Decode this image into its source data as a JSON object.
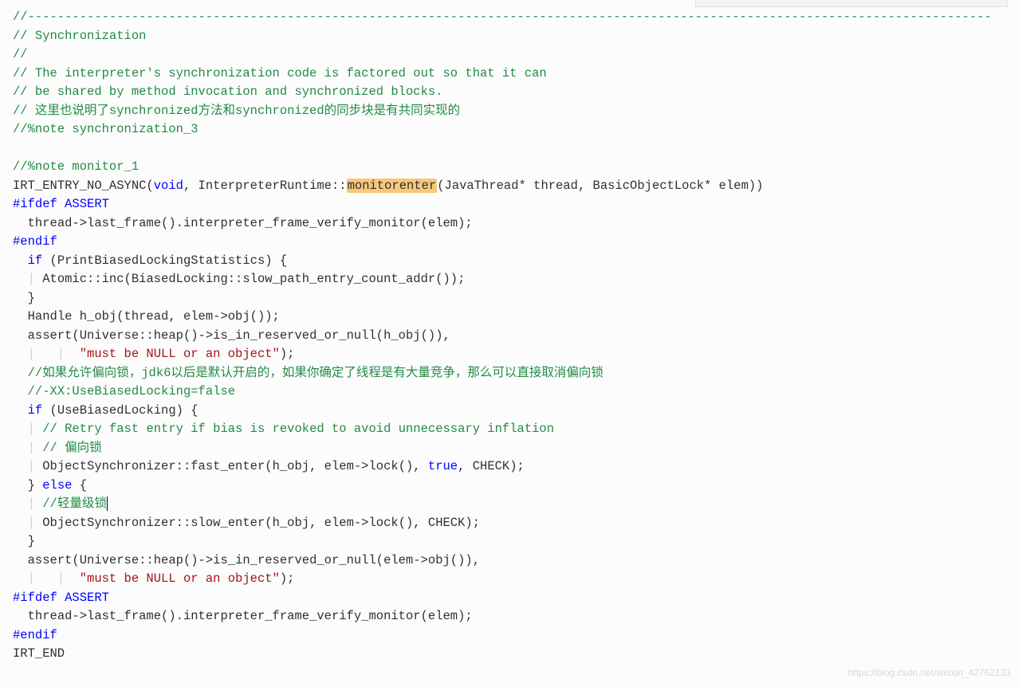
{
  "lines": [
    [
      {
        "cls": "cmt",
        "t": "//----------------------------------------------------------------------------------------------------------------------------------"
      }
    ],
    [
      {
        "cls": "cmt",
        "t": "// Synchronization"
      }
    ],
    [
      {
        "cls": "cmt",
        "t": "//"
      }
    ],
    [
      {
        "cls": "cmt",
        "t": "// The interpreter's synchronization code is factored out so that it can"
      }
    ],
    [
      {
        "cls": "cmt",
        "t": "// be shared by method invocation and synchronized blocks."
      }
    ],
    [
      {
        "cls": "cmt",
        "t": "// 这里也说明了synchronized方法和synchronized的同步块是有共同实现的"
      }
    ],
    [
      {
        "cls": "cmt",
        "t": "//%note synchronization_3"
      }
    ],
    [],
    [
      {
        "cls": "cmt",
        "t": "//%note monitor_1"
      }
    ],
    [
      {
        "cls": "pl",
        "t": "IRT_ENTRY_NO_ASYNC("
      },
      {
        "cls": "kw",
        "t": "void"
      },
      {
        "cls": "pl",
        "t": ", InterpreterRuntime::"
      },
      {
        "cls": "hl",
        "t": "monitorenter"
      },
      {
        "cls": "pl",
        "t": "(JavaThread* thread, BasicObjectLock* elem))"
      }
    ],
    [
      {
        "cls": "kw",
        "t": "#ifdef ASSERT"
      }
    ],
    [
      {
        "cls": "guide",
        "t": "  "
      },
      {
        "cls": "pl",
        "t": "thread->last_frame().interpreter_frame_verify_monitor(elem);"
      }
    ],
    [
      {
        "cls": "kw",
        "t": "#endif"
      }
    ],
    [
      {
        "cls": "guide",
        "t": "  "
      },
      {
        "cls": "kw",
        "t": "if"
      },
      {
        "cls": "pl",
        "t": " (PrintBiasedLockingStatistics) {"
      }
    ],
    [
      {
        "cls": "guide",
        "t": "  | "
      },
      {
        "cls": "pl",
        "t": "Atomic::inc(BiasedLocking::slow_path_entry_count_addr());"
      }
    ],
    [
      {
        "cls": "guide",
        "t": "  "
      },
      {
        "cls": "pl",
        "t": "}"
      }
    ],
    [
      {
        "cls": "guide",
        "t": "  "
      },
      {
        "cls": "pl",
        "t": "Handle h_obj(thread, elem->obj());"
      }
    ],
    [
      {
        "cls": "guide",
        "t": "  "
      },
      {
        "cls": "pl",
        "t": "assert(Universe::heap()->is_in_reserved_or_null(h_obj()),"
      }
    ],
    [
      {
        "cls": "guide",
        "t": "  |   |  "
      },
      {
        "cls": "str",
        "t": "\"must be NULL or an object\""
      },
      {
        "cls": "pl",
        "t": ");"
      }
    ],
    [
      {
        "cls": "guide",
        "t": "  "
      },
      {
        "cls": "cmt",
        "t": "//如果允许偏向锁，jdk6以后是默认开启的，如果你确定了线程是有大量竞争，那么可以直接取消偏向锁"
      }
    ],
    [
      {
        "cls": "guide",
        "t": "  "
      },
      {
        "cls": "cmt",
        "t": "//-XX:UseBiasedLocking=false"
      }
    ],
    [
      {
        "cls": "guide",
        "t": "  "
      },
      {
        "cls": "kw",
        "t": "if"
      },
      {
        "cls": "pl",
        "t": " (UseBiasedLocking) {"
      }
    ],
    [
      {
        "cls": "guide",
        "t": "  | "
      },
      {
        "cls": "cmt",
        "t": "// Retry fast entry if bias is revoked to avoid unnecessary inflation"
      }
    ],
    [
      {
        "cls": "guide",
        "t": "  | "
      },
      {
        "cls": "cmt",
        "t": "// 偏向锁"
      }
    ],
    [
      {
        "cls": "guide",
        "t": "  | "
      },
      {
        "cls": "pl",
        "t": "ObjectSynchronizer::fast_enter(h_obj, elem->lock(), "
      },
      {
        "cls": "kw",
        "t": "true"
      },
      {
        "cls": "pl",
        "t": ", CHECK);"
      }
    ],
    [
      {
        "cls": "guide",
        "t": "  "
      },
      {
        "cls": "pl",
        "t": "} "
      },
      {
        "cls": "kw",
        "t": "else"
      },
      {
        "cls": "pl",
        "t": " {"
      }
    ],
    [
      {
        "cls": "guide",
        "t": "  | "
      },
      {
        "cls": "cmt",
        "t": "//轻量级锁"
      },
      {
        "cls": "cursor",
        "t": ""
      }
    ],
    [
      {
        "cls": "guide",
        "t": "  | "
      },
      {
        "cls": "pl",
        "t": "ObjectSynchronizer::slow_enter(h_obj, elem->lock(), CHECK);"
      }
    ],
    [
      {
        "cls": "guide",
        "t": "  "
      },
      {
        "cls": "pl",
        "t": "}"
      }
    ],
    [
      {
        "cls": "guide",
        "t": "  "
      },
      {
        "cls": "pl",
        "t": "assert(Universe::heap()->is_in_reserved_or_null(elem->obj()),"
      }
    ],
    [
      {
        "cls": "guide",
        "t": "  |   |  "
      },
      {
        "cls": "str",
        "t": "\"must be NULL or an object\""
      },
      {
        "cls": "pl",
        "t": ");"
      }
    ],
    [
      {
        "cls": "kw",
        "t": "#ifdef ASSERT"
      }
    ],
    [
      {
        "cls": "guide",
        "t": "  "
      },
      {
        "cls": "pl",
        "t": "thread->last_frame().interpreter_frame_verify_monitor(elem);"
      }
    ],
    [
      {
        "cls": "kw",
        "t": "#endif"
      }
    ],
    [
      {
        "cls": "pl",
        "t": "IRT_END"
      }
    ]
  ],
  "current_line_index": 26,
  "watermark": "https://blog.csdn.net/weixin_42762133"
}
